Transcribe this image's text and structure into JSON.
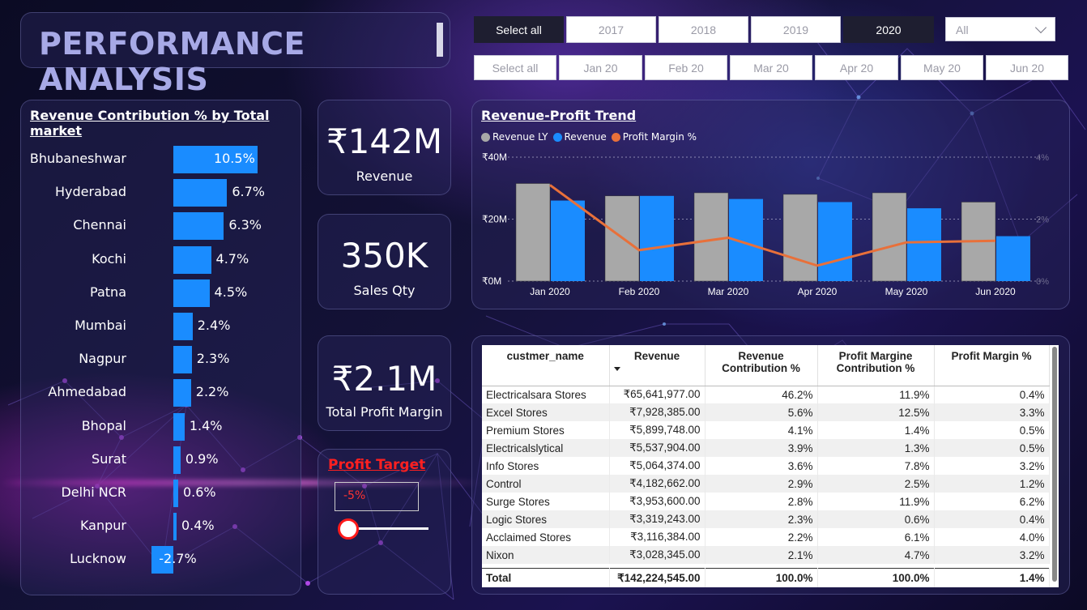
{
  "header": {
    "title": "PERFORMANCE ANALYSIS"
  },
  "year_slicer": {
    "items": [
      "Select all",
      "2017",
      "2018",
      "2019",
      "2020"
    ],
    "selected": [
      "Select all",
      "2020"
    ]
  },
  "dropdown": {
    "value": "All"
  },
  "month_slicer": {
    "items": [
      "Select all",
      "Jan 20",
      "Feb 20",
      "Mar 20",
      "Apr 20",
      "May 20",
      "Jun 20"
    ]
  },
  "revenue_contribution": {
    "title": "Revenue Contribution % by Total market",
    "rows": [
      {
        "city": "Bhubaneshwar",
        "value": 10.5,
        "label": "10.5%"
      },
      {
        "city": "Hyderabad",
        "value": 6.7,
        "label": "6.7%"
      },
      {
        "city": "Chennai",
        "value": 6.3,
        "label": "6.3%"
      },
      {
        "city": "Kochi",
        "value": 4.7,
        "label": "4.7%"
      },
      {
        "city": "Patna",
        "value": 4.5,
        "label": "4.5%"
      },
      {
        "city": "Mumbai",
        "value": 2.4,
        "label": "2.4%"
      },
      {
        "city": "Nagpur",
        "value": 2.3,
        "label": "2.3%"
      },
      {
        "city": "Ahmedabad",
        "value": 2.2,
        "label": "2.2%"
      },
      {
        "city": "Bhopal",
        "value": 1.4,
        "label": "1.4%"
      },
      {
        "city": "Surat",
        "value": 0.9,
        "label": "0.9%"
      },
      {
        "city": "Delhi NCR",
        "value": 0.6,
        "label": "0.6%"
      },
      {
        "city": "Kanpur",
        "value": 0.4,
        "label": "0.4%"
      },
      {
        "city": "Lucknow",
        "value": -2.7,
        "label": "-2.7%"
      }
    ],
    "bar_color": "#1a8cff"
  },
  "kpis": {
    "revenue": {
      "value": "₹142M",
      "label": "Revenue"
    },
    "sales_qty": {
      "value": "350K",
      "label": "Sales Qty"
    },
    "profit_margin": {
      "value": "₹2.1M",
      "label": "Total Profit Margin"
    }
  },
  "profit_target": {
    "title": "Profit Target",
    "value": "-5%"
  },
  "trend": {
    "title": "Revenue-Profit Trend",
    "legend": [
      {
        "name": "Revenue LY",
        "color": "#a8a8a8"
      },
      {
        "name": "Revenue",
        "color": "#1a8cff"
      },
      {
        "name": "Profit Margin %",
        "color": "#e8703a"
      }
    ],
    "y_left_ticks": [
      "₹40M",
      "₹20M",
      "₹0M"
    ],
    "y_right_ticks": [
      "4%",
      "2%",
      "0%"
    ]
  },
  "chart_data": {
    "type": "bar",
    "title": "Revenue-Profit Trend",
    "categories": [
      "Jan 2020",
      "Feb 2020",
      "Mar 2020",
      "Apr 2020",
      "May 2020",
      "Jun 2020"
    ],
    "ylim": [
      0,
      40
    ],
    "y2lim": [
      0,
      4
    ],
    "series": [
      {
        "name": "Revenue LY",
        "type": "bar",
        "values": [
          31.5,
          27.5,
          28.5,
          28,
          28.5,
          25.5
        ]
      },
      {
        "name": "Revenue",
        "type": "bar",
        "values": [
          26,
          27.5,
          26.5,
          25.5,
          23.5,
          14.5
        ]
      },
      {
        "name": "Profit Margin %",
        "type": "line",
        "axis": "right",
        "values": [
          3.1,
          1.0,
          1.4,
          0.5,
          1.25,
          1.3
        ]
      }
    ]
  },
  "table": {
    "columns": [
      "custmer_name",
      "Revenue",
      "Revenue Contribution %",
      "Profit Margine Contribution %",
      "Profit Margin %"
    ],
    "rows": [
      [
        "Electricalsara Stores",
        "₹65,641,977.00",
        "46.2%",
        "11.9%",
        "0.4%"
      ],
      [
        "Excel Stores",
        "₹7,928,385.00",
        "5.6%",
        "12.5%",
        "3.3%"
      ],
      [
        "Premium Stores",
        "₹5,899,748.00",
        "4.1%",
        "1.4%",
        "0.5%"
      ],
      [
        "Electricalslytical",
        "₹5,537,904.00",
        "3.9%",
        "1.3%",
        "0.5%"
      ],
      [
        "Info Stores",
        "₹5,064,374.00",
        "3.6%",
        "7.8%",
        "3.2%"
      ],
      [
        "Control",
        "₹4,182,662.00",
        "2.9%",
        "2.5%",
        "1.2%"
      ],
      [
        "Surge Stores",
        "₹3,953,600.00",
        "2.8%",
        "11.9%",
        "6.2%"
      ],
      [
        "Logic Stores",
        "₹3,319,243.00",
        "2.3%",
        "0.6%",
        "0.4%"
      ],
      [
        "Acclaimed Stores",
        "₹3,116,384.00",
        "2.2%",
        "6.1%",
        "4.0%"
      ],
      [
        "Nixon",
        "₹3,028,345.00",
        "2.1%",
        "4.7%",
        "3.2%"
      ]
    ],
    "total": [
      "Total",
      "₹142,224,545.00",
      "100.0%",
      "100.0%",
      "1.4%"
    ]
  }
}
